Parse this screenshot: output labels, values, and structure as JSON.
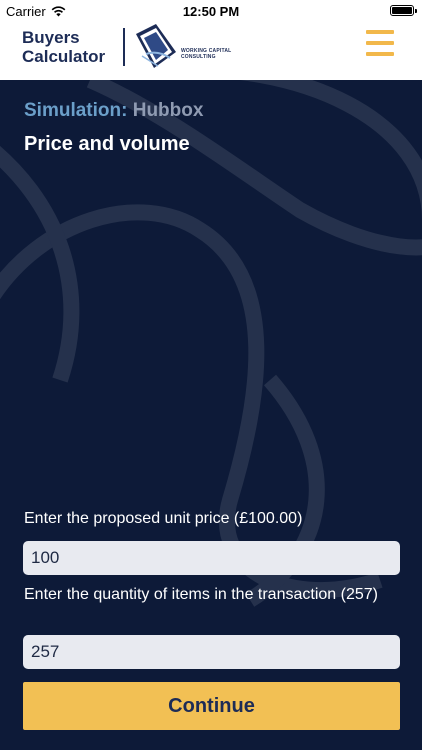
{
  "status_bar": {
    "carrier": "Carrier",
    "time": "12:50 PM",
    "icons": [
      "wifi-icon",
      "battery-icon"
    ]
  },
  "header": {
    "brand_line1": "Buyers",
    "brand_line2": "Calculator",
    "partner_line1": "WORKING CAPITAL",
    "partner_line2": "CONSULTING",
    "menu_icon": "hamburger-menu-icon"
  },
  "simulation": {
    "label": "Simulation:",
    "name": "Hubbox"
  },
  "section_title": "Price and volume",
  "form": {
    "unit_price": {
      "label": "Enter the proposed unit price (£100.00)",
      "value": "100"
    },
    "quantity": {
      "label": "Enter the quantity of items in the transaction (257)",
      "value": "257"
    },
    "continue_label": "Continue"
  },
  "colors": {
    "background": "#0d1a38",
    "accent": "#f2c054",
    "brand_navy": "#1d2c56",
    "sim_label": "#6b9fc9"
  }
}
